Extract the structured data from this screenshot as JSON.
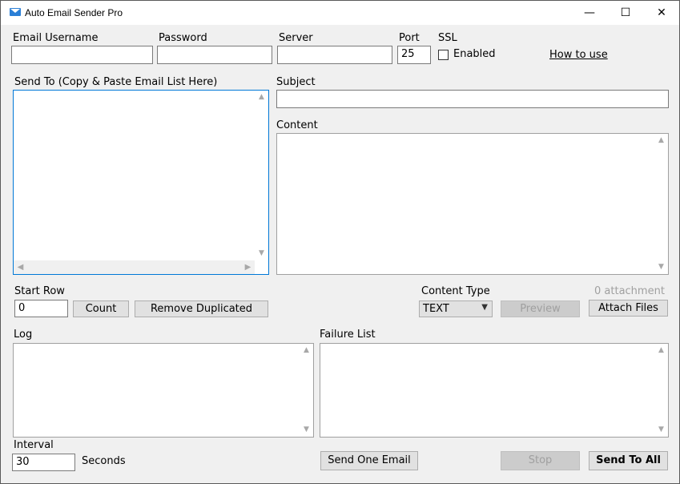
{
  "window": {
    "title": "Auto Email Sender Pro"
  },
  "titlebar": {
    "minimize": "—",
    "maximize": "☐",
    "close": "✕"
  },
  "fields": {
    "email_username_label": "Email Username",
    "email_username_value": "",
    "password_label": "Password",
    "password_value": "",
    "server_label": "Server",
    "server_value": "",
    "port_label": "Port",
    "port_value": "25",
    "ssl_label": "SSL",
    "ssl_enabled_label": "Enabled",
    "ssl_enabled": false,
    "how_to_use": "How to use"
  },
  "send_to": {
    "label": "Send To (Copy & Paste Email List Here)",
    "value": ""
  },
  "subject": {
    "label": "Subject",
    "value": ""
  },
  "content": {
    "label": "Content",
    "value": ""
  },
  "start_row": {
    "label": "Start Row",
    "value": "0"
  },
  "buttons": {
    "count": "Count",
    "remove_duplicated": "Remove Duplicated",
    "preview": "Preview",
    "attach_files": "Attach Files",
    "send_one": "Send One Email",
    "stop": "Stop",
    "send_to_all": "Send To All"
  },
  "content_type": {
    "label": "Content Type",
    "selected": "TEXT"
  },
  "attachment_count": "0 attachment",
  "log": {
    "label": "Log",
    "value": ""
  },
  "failure_list": {
    "label": "Failure List",
    "value": ""
  },
  "interval": {
    "label": "Interval",
    "value": "30",
    "unit": "Seconds"
  },
  "colors": {
    "focus_border": "#0078d7",
    "disabled_text": "#a0a0a0",
    "app_icon": "#2b7fd6"
  }
}
